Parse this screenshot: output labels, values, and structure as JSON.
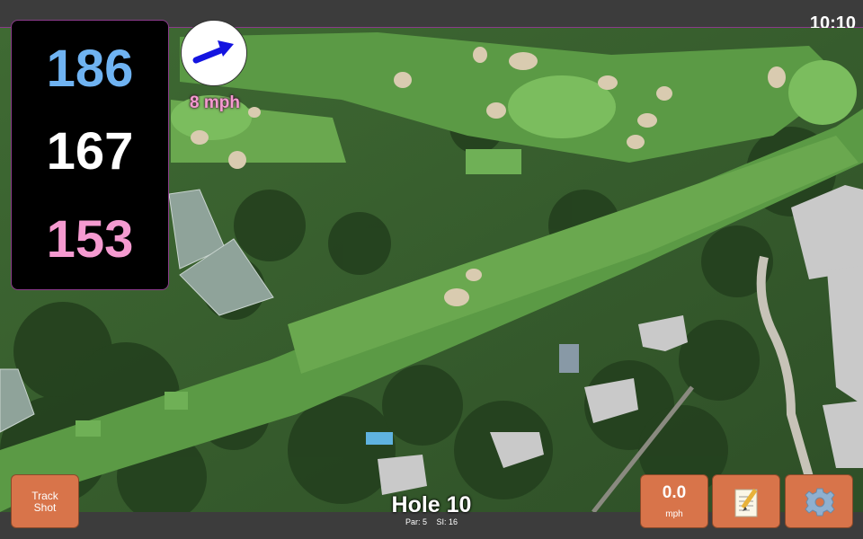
{
  "status": {
    "time": "10:10"
  },
  "distances": {
    "back": "186",
    "middle": "167",
    "front": "153"
  },
  "wind": {
    "speed": "8 mph",
    "icon": "wind-direction-arrow-icon"
  },
  "hole": {
    "title": "Hole 10",
    "par": "Par: 5",
    "si": "SI: 16"
  },
  "buttons": {
    "track_shot_line1": "Track",
    "track_shot_line2": "Shot",
    "speed_value": "0.0",
    "speed_unit": "mph",
    "notes_icon": "notepad-icon",
    "settings_icon": "gear-icon"
  },
  "colors": {
    "back": "#6fb3f2",
    "middle": "#ffffff",
    "front": "#f59ad0",
    "button": "#d8744a",
    "accent_border": "#8a3a8a"
  }
}
